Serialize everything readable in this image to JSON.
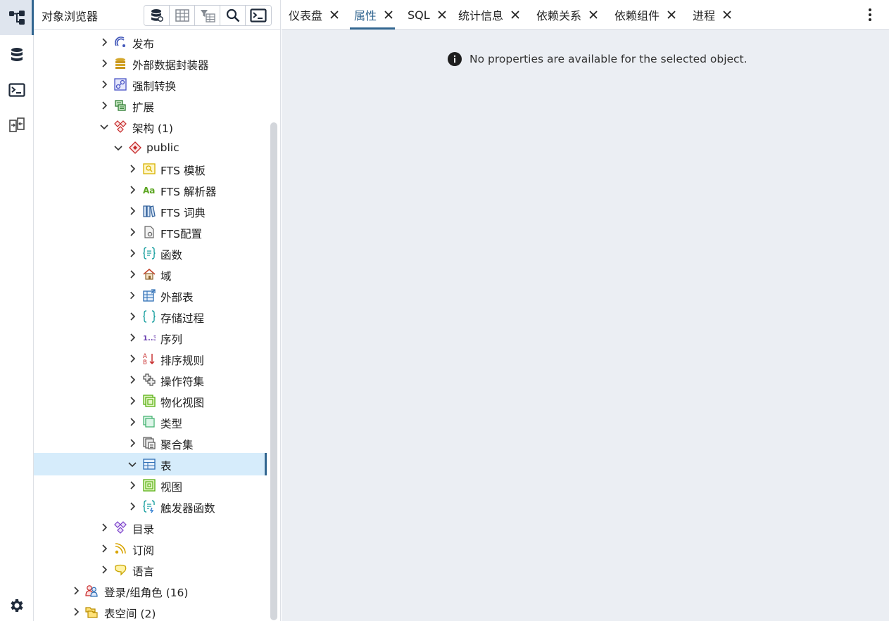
{
  "rail": {
    "items": [
      {
        "icon": "object-explorer-icon",
        "active": true
      },
      {
        "icon": "database-icon",
        "active": false
      },
      {
        "icon": "terminal-icon",
        "active": false
      },
      {
        "icon": "schema-diff-icon",
        "active": false
      }
    ],
    "settings_icon": "gear-icon"
  },
  "browser": {
    "title": "对象浏览器",
    "toolbar": [
      "query-tool-icon",
      "view-data-icon",
      "filtered-rows-icon",
      "search-icon",
      "psql-tool-icon"
    ]
  },
  "tree": [
    {
      "label": "发布",
      "icon": "publication-icon",
      "expanded": false
    },
    {
      "label": "外部数据封装器",
      "icon": "foreign-data-wrapper-icon",
      "expanded": false
    },
    {
      "label": "强制转换",
      "icon": "cast-icon",
      "expanded": false
    },
    {
      "label": "扩展",
      "icon": "extension-icon",
      "expanded": false
    },
    {
      "label": "架构 (1)",
      "icon": "schemas-icon",
      "expanded": true
    },
    {
      "label": "public",
      "icon": "schema-icon",
      "expanded": true
    },
    {
      "label": "FTS 模板",
      "icon": "fts-template-icon",
      "expanded": false
    },
    {
      "label": "FTS 解析器",
      "icon": "fts-parser-icon",
      "expanded": false
    },
    {
      "label": "FTS 词典",
      "icon": "fts-dictionary-icon",
      "expanded": false
    },
    {
      "label": "FTS配置",
      "icon": "fts-configuration-icon",
      "expanded": false
    },
    {
      "label": "函数",
      "icon": "function-icon",
      "expanded": false
    },
    {
      "label": "域",
      "icon": "domain-icon",
      "expanded": false
    },
    {
      "label": "外部表",
      "icon": "foreign-table-icon",
      "expanded": false
    },
    {
      "label": "存储过程",
      "icon": "procedure-icon",
      "expanded": false
    },
    {
      "label": "序列",
      "icon": "sequence-icon",
      "expanded": false
    },
    {
      "label": "排序规则",
      "icon": "collation-icon",
      "expanded": false
    },
    {
      "label": "操作符集",
      "icon": "operator-icon",
      "expanded": false
    },
    {
      "label": "物化视图",
      "icon": "materialized-view-icon",
      "expanded": false
    },
    {
      "label": "类型",
      "icon": "type-icon",
      "expanded": false
    },
    {
      "label": "聚合集",
      "icon": "aggregate-icon",
      "expanded": false
    },
    {
      "label": "表",
      "icon": "table-icon",
      "expanded": true,
      "selected": true
    },
    {
      "label": "视图",
      "icon": "view-icon",
      "expanded": false
    },
    {
      "label": "触发器函数",
      "icon": "trigger-function-icon",
      "expanded": false
    },
    {
      "label": "目录",
      "icon": "catalog-icon",
      "expanded": false
    },
    {
      "label": "订阅",
      "icon": "subscription-icon",
      "expanded": false
    },
    {
      "label": "语言",
      "icon": "language-icon",
      "expanded": false
    },
    {
      "label": "登录/组角色 (16)",
      "icon": "roles-icon",
      "expanded": false
    },
    {
      "label": "表空间 (2)",
      "icon": "tablespace-icon",
      "expanded": false
    }
  ],
  "tabs": [
    {
      "label": "仪表盘",
      "active": false
    },
    {
      "label": "属性",
      "active": true
    },
    {
      "label": "SQL",
      "active": false
    },
    {
      "label": "统计信息",
      "active": false
    },
    {
      "label": "依赖关系",
      "active": false
    },
    {
      "label": "依赖组件",
      "active": false
    },
    {
      "label": "进程",
      "active": false
    }
  ],
  "main": {
    "message": "No properties are available for the selected object.",
    "message_icon": "info-icon"
  },
  "colors": {
    "accent": "#326690",
    "selection": "#d6ecfb",
    "panel_bg": "#ebeef3"
  }
}
